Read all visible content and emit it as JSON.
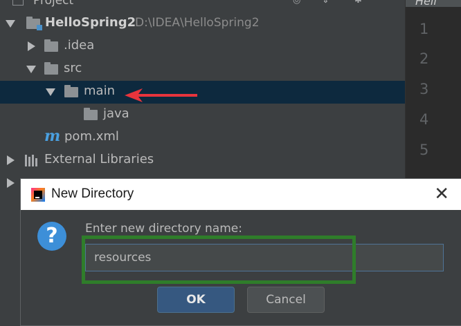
{
  "project_panel": {
    "title": "Project"
  },
  "tree": {
    "root": {
      "label": "HelloSpring2",
      "path": "D:\\IDEA\\HelloSpring2"
    },
    "items": [
      {
        "label": ".idea"
      },
      {
        "label": "src"
      },
      {
        "label": "main"
      },
      {
        "label": "java"
      },
      {
        "label": "pom.xml"
      },
      {
        "label": "External Libraries"
      }
    ]
  },
  "editor": {
    "tab_label": "Hell",
    "line_numbers": [
      "1",
      "2",
      "3",
      "4",
      "5"
    ]
  },
  "dialog": {
    "title": "New Directory",
    "close_glyph": "✕",
    "prompt": "Enter new directory name:",
    "input_value": "resources",
    "ok_label": "OK",
    "cancel_label": "Cancel"
  },
  "colors": {
    "selection": "#0d293e",
    "annotation_arrow": "#e8343c",
    "annotation_box": "#2f7d2a",
    "ok_button": "#365880"
  }
}
